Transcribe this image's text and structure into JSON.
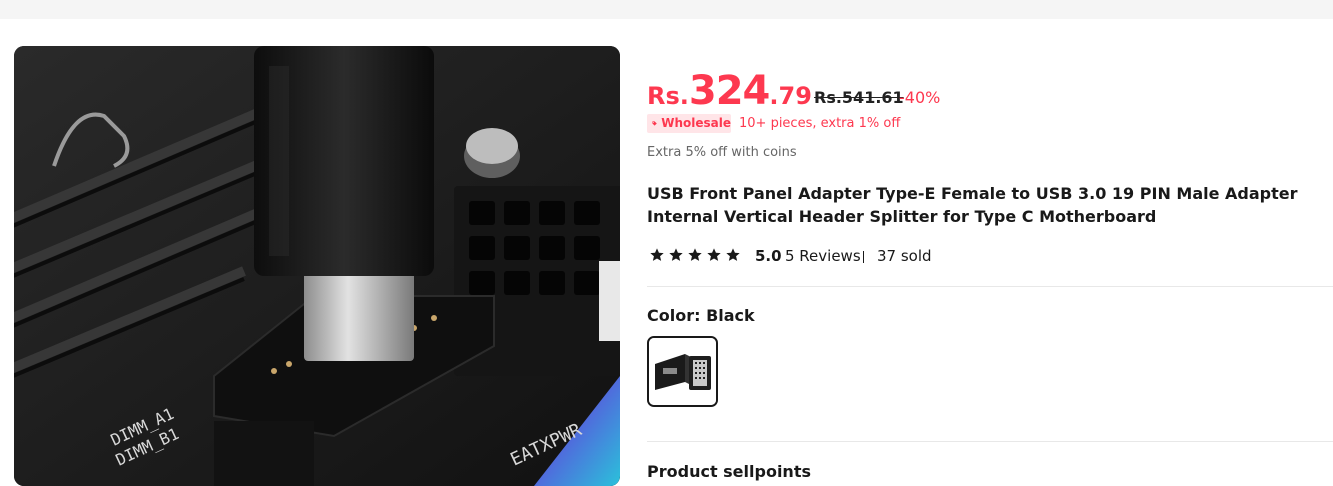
{
  "product": {
    "image_alt": "USB Type-E front panel adapter plugged into motherboard header",
    "price": {
      "currency": "Rs.",
      "integer": "324",
      "decimal": ".79",
      "original": "Rs.541.61",
      "discount": "-40%"
    },
    "wholesale": {
      "badge_label": "Wholesale",
      "badge_icon": "tag-icon",
      "text": "10+ pieces, extra 1% off"
    },
    "coins_text": "Extra 5% off with coins",
    "title": "USB Front Panel Adapter Type-E Female to USB 3.0 19 PIN Male Adapter Internal Vertical Header Splitter for Type C Motherboard",
    "rating": {
      "stars": 5,
      "score": "5.0",
      "reviews": "5 Reviews",
      "sold": "37 sold"
    },
    "color": {
      "label": "Color: Black",
      "options": [
        {
          "name": "Black",
          "selected": true
        }
      ]
    },
    "sellpoints_title": "Product sellpoints"
  },
  "colors": {
    "accent": "#fd384f",
    "badge_bg": "#ffe5e8",
    "text": "#191919",
    "muted": "#666666",
    "topbar": "#f5f5f5"
  }
}
